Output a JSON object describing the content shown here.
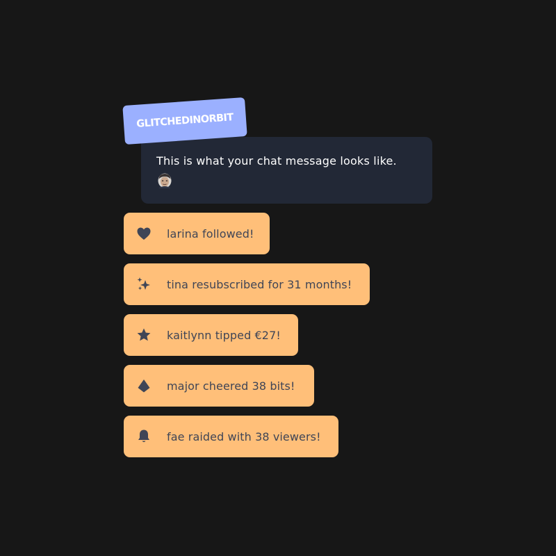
{
  "chat": {
    "username": "GLITCHEDINORBIT",
    "message": "This is what your chat message looks like.",
    "emote_icon": "face-emote-icon",
    "badge_color": "#9bb0ff",
    "bubble_color": "#222836"
  },
  "alerts": [
    {
      "icon": "heart-icon",
      "text": "larina followed!"
    },
    {
      "icon": "sparkles-icon",
      "text": "tina resubscribed for 31 months!"
    },
    {
      "icon": "star-icon",
      "text": "kaitlynn tipped €27!"
    },
    {
      "icon": "gem-icon",
      "text": "major cheered 38 bits!"
    },
    {
      "icon": "bell-icon",
      "text": "fae raided with 38 viewers!"
    }
  ],
  "colors": {
    "background": "#171717",
    "alert_background": "#ffbf79",
    "alert_text": "#3f4556"
  }
}
